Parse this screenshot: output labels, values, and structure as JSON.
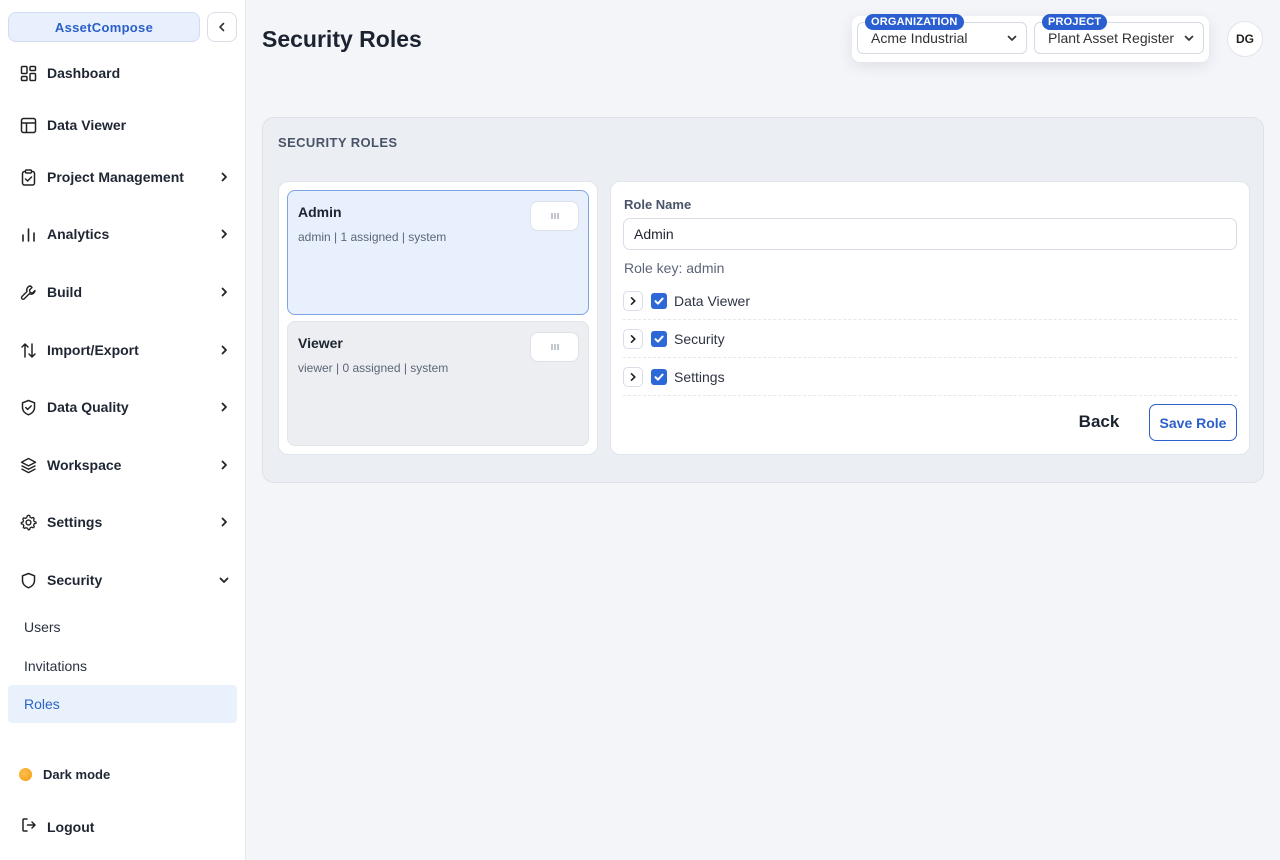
{
  "app": {
    "brand": "AssetCompose"
  },
  "sidebar": {
    "items": [
      {
        "label": "Dashboard"
      },
      {
        "label": "Data Viewer"
      },
      {
        "label": "Project Management"
      },
      {
        "label": "Analytics"
      },
      {
        "label": "Build"
      },
      {
        "label": "Import/Export"
      },
      {
        "label": "Data Quality"
      },
      {
        "label": "Workspace"
      },
      {
        "label": "Settings"
      },
      {
        "label": "Security"
      }
    ],
    "security_sub": [
      {
        "label": "Users"
      },
      {
        "label": "Invitations"
      },
      {
        "label": "Roles"
      }
    ],
    "dark_mode_label": "Dark mode",
    "logout_label": "Logout"
  },
  "header": {
    "title": "Security Roles",
    "organization": {
      "tag": "ORGANIZATION",
      "value": "Acme Industrial"
    },
    "project": {
      "tag": "PROJECT",
      "value": "Plant Asset Register"
    },
    "avatar_initials": "DG"
  },
  "panel": {
    "heading": "SECURITY ROLES",
    "roles": [
      {
        "name": "Admin",
        "meta": "admin | 1 assigned | system"
      },
      {
        "name": "Viewer",
        "meta": "viewer | 0 assigned | system"
      }
    ],
    "editor": {
      "role_name_label": "Role Name",
      "role_name_value": "Admin",
      "role_key": "Role key: admin",
      "permissions": [
        {
          "label": "Data Viewer",
          "checked": true
        },
        {
          "label": "Security",
          "checked": true
        },
        {
          "label": "Settings",
          "checked": true
        }
      ],
      "back_label": "Back",
      "save_label": "Save Role"
    }
  },
  "colors": {
    "accent": "#2b5fc9",
    "selected_bg": "#e8f0fd",
    "sidebar_active_bg": "#e9f1fc"
  }
}
